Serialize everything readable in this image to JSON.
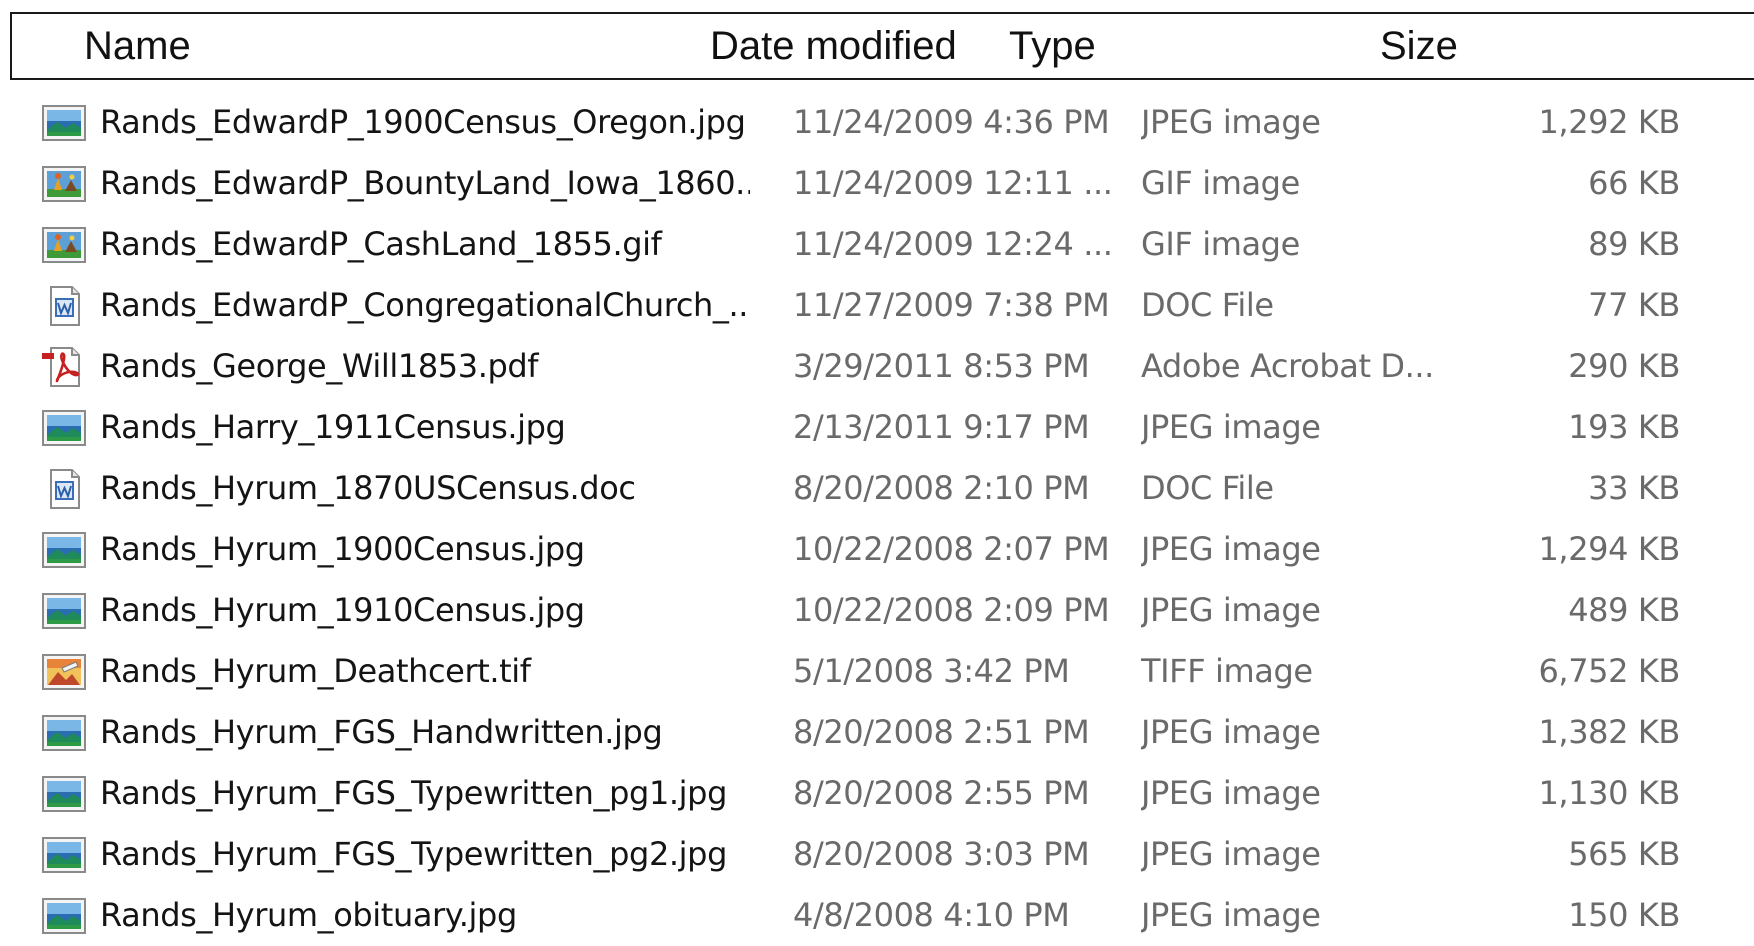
{
  "columns": {
    "name": "Name",
    "date": "Date modified",
    "type": "Type",
    "size": "Size"
  },
  "files": [
    {
      "name": "Rands_EdwardP_1900Census_Oregon.jpg",
      "date": "11/24/2009 4:36 PM",
      "type": "JPEG image",
      "size": "1,292 KB",
      "icon": "jpeg-image-icon"
    },
    {
      "name": "Rands_EdwardP_BountyLand_Iowa_1860....",
      "date": "11/24/2009 12:11 ...",
      "type": "GIF image",
      "size": "66 KB",
      "icon": "gif-image-icon"
    },
    {
      "name": "Rands_EdwardP_CashLand_1855.gif",
      "date": "11/24/2009 12:24 ...",
      "type": "GIF image",
      "size": "89 KB",
      "icon": "gif-image-icon"
    },
    {
      "name": "Rands_EdwardP_CongregationalChurch_...",
      "date": "11/27/2009 7:38 PM",
      "type": "DOC File",
      "size": "77 KB",
      "icon": "doc-file-icon"
    },
    {
      "name": "Rands_George_Will1853.pdf",
      "date": "3/29/2011 8:53 PM",
      "type": "Adobe Acrobat D...",
      "size": "290 KB",
      "icon": "pdf-file-icon"
    },
    {
      "name": "Rands_Harry_1911Census.jpg",
      "date": "2/13/2011 9:17 PM",
      "type": "JPEG image",
      "size": "193 KB",
      "icon": "jpeg-image-icon"
    },
    {
      "name": "Rands_Hyrum_1870USCensus.doc",
      "date": "8/20/2008 2:10 PM",
      "type": "DOC File",
      "size": "33 KB",
      "icon": "doc-file-icon"
    },
    {
      "name": "Rands_Hyrum_1900Census.jpg",
      "date": "10/22/2008 2:07 PM",
      "type": "JPEG image",
      "size": "1,294 KB",
      "icon": "jpeg-image-icon"
    },
    {
      "name": "Rands_Hyrum_1910Census.jpg",
      "date": "10/22/2008 2:09 PM",
      "type": "JPEG image",
      "size": "489 KB",
      "icon": "jpeg-image-icon"
    },
    {
      "name": "Rands_Hyrum_Deathcert.tif",
      "date": "5/1/2008 3:42 PM",
      "type": "TIFF image",
      "size": "6,752 KB",
      "icon": "tiff-image-icon"
    },
    {
      "name": "Rands_Hyrum_FGS_Handwritten.jpg",
      "date": "8/20/2008 2:51 PM",
      "type": "JPEG image",
      "size": "1,382 KB",
      "icon": "jpeg-image-icon"
    },
    {
      "name": "Rands_Hyrum_FGS_Typewritten_pg1.jpg",
      "date": "8/20/2008 2:55 PM",
      "type": "JPEG image",
      "size": "1,130 KB",
      "icon": "jpeg-image-icon"
    },
    {
      "name": "Rands_Hyrum_FGS_Typewritten_pg2.jpg",
      "date": "8/20/2008 3:03 PM",
      "type": "JPEG image",
      "size": "565 KB",
      "icon": "jpeg-image-icon"
    },
    {
      "name": "Rands_Hyrum_obituary.jpg",
      "date": "4/8/2008 4:10 PM",
      "type": "JPEG image",
      "size": "150 KB",
      "icon": "jpeg-image-icon"
    }
  ]
}
